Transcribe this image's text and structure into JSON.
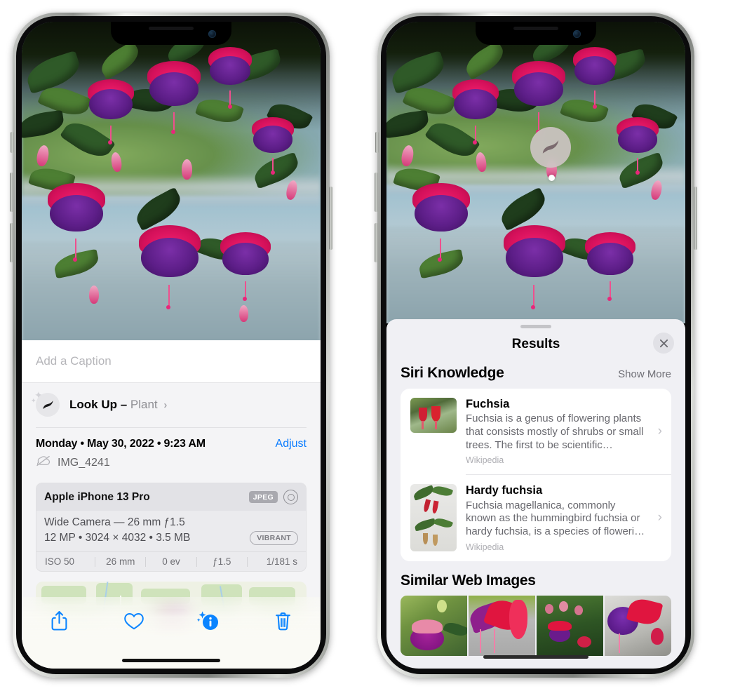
{
  "left_phone": {
    "caption_placeholder": "Add a Caption",
    "lookup": {
      "title": "Look Up –",
      "subject": "Plant",
      "chevron": "›",
      "icon": "leaf-icon"
    },
    "meta": {
      "date": "Monday • May 30, 2022 • 9:23 AM",
      "adjust_label": "Adjust",
      "filename": "IMG_4241",
      "cloud_icon": "icloud-slash-icon"
    },
    "exif": {
      "device": "Apple iPhone 13 Pro",
      "format_badge": "JPEG",
      "lens_icon": "lens-icon",
      "line1": "Wide Camera — 26 mm ƒ1.5",
      "line2": "12 MP • 3024 × 4032 • 3.5 MB",
      "style_badge": "VIBRANT",
      "stats": [
        "ISO 50",
        "26 mm",
        "0 ev",
        "ƒ1.5",
        "1/181 s"
      ]
    },
    "toolbar": [
      {
        "name": "share-button",
        "icon": "share-icon"
      },
      {
        "name": "favorite-button",
        "icon": "heart-icon"
      },
      {
        "name": "info-button",
        "icon": "info-sparkle-icon"
      },
      {
        "name": "delete-button",
        "icon": "trash-icon"
      }
    ]
  },
  "right_phone": {
    "leaf_badge_icon": "leaf-icon",
    "sheet": {
      "title": "Results",
      "close_icon": "close-icon",
      "siri_section": {
        "title": "Siri Knowledge",
        "action": "Show More"
      },
      "knowledge": [
        {
          "title": "Fuchsia",
          "description": "Fuchsia is a genus of flowering plants that consists mostly of shrubs or small trees. The first to be scientific…",
          "source": "Wikipedia",
          "chevron": "›"
        },
        {
          "title": "Hardy fuchsia",
          "description": "Fuchsia magellanica, commonly known as the hummingbird fuchsia or hardy fuchsia, is a species of floweri…",
          "source": "Wikipedia",
          "chevron": "›"
        }
      ],
      "web_section": {
        "title": "Similar Web Images"
      },
      "web_images": [
        "web-image-1",
        "web-image-2",
        "web-image-3",
        "web-image-4"
      ]
    }
  },
  "colors": {
    "accent_blue": "#0a7cff",
    "sheet_bg": "#f0f0f4",
    "card_bg": "#ffffff",
    "secondary_text": "#8e8e93"
  }
}
